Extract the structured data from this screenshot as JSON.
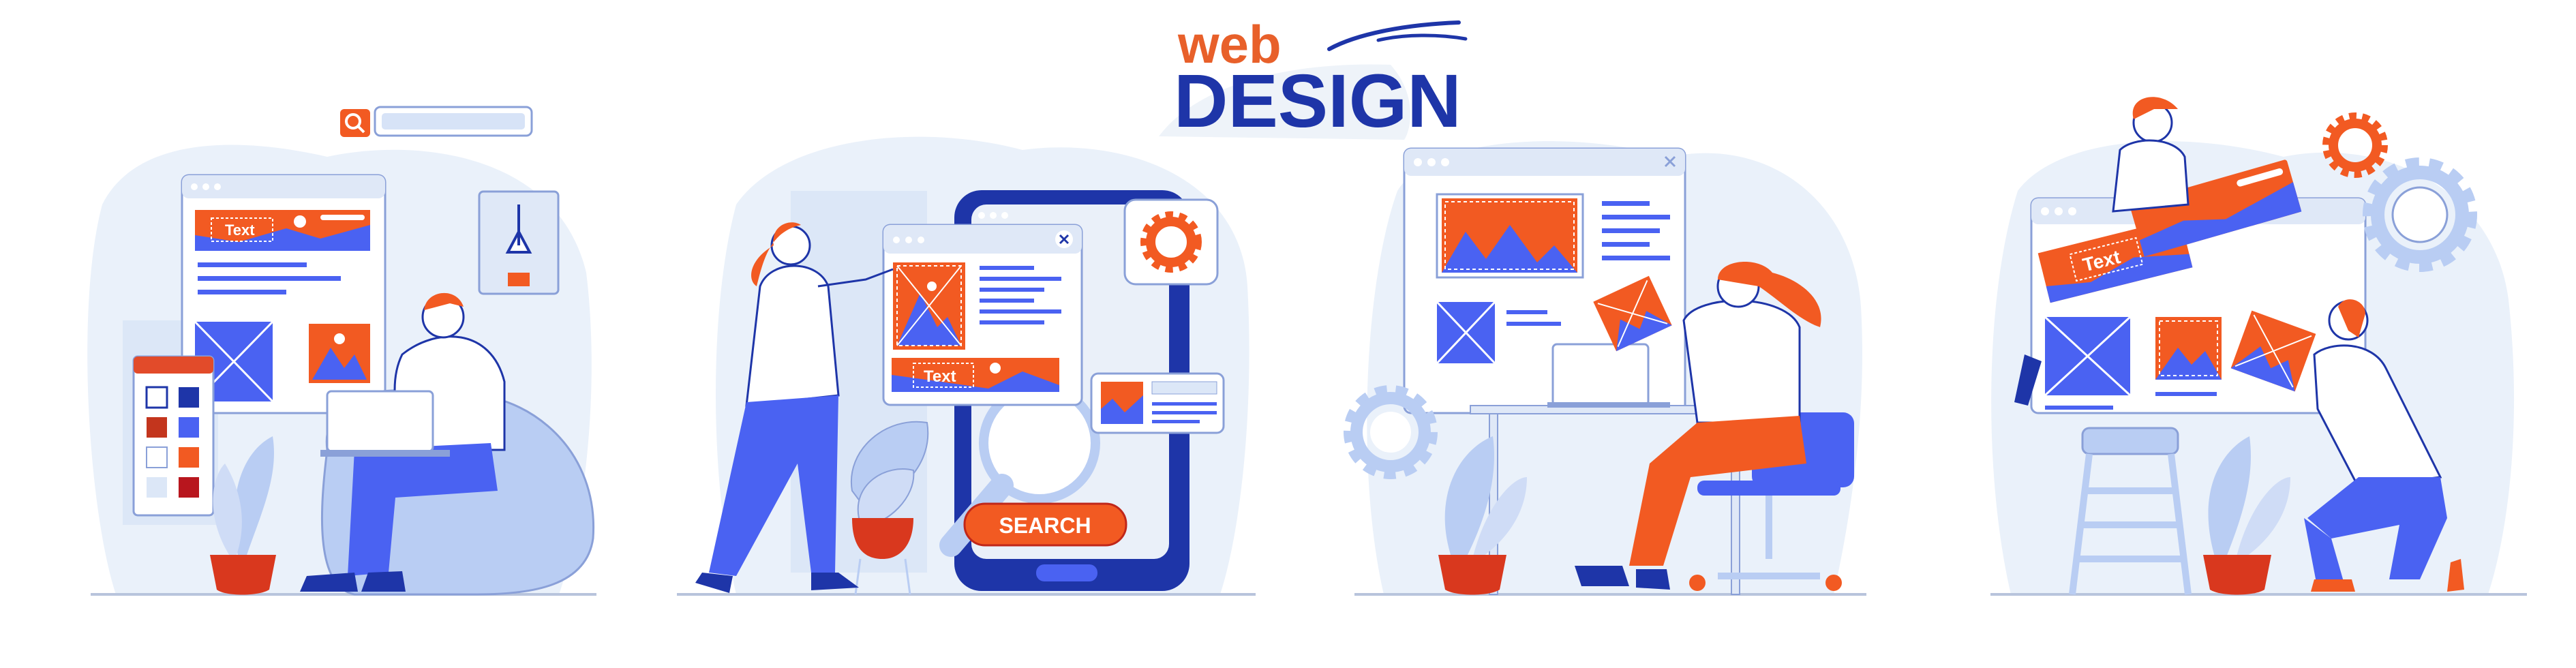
{
  "title": {
    "web": "web",
    "design": "DESIGN"
  },
  "scene1": {
    "banner_text": "Text"
  },
  "scene2": {
    "banner_text": "Text",
    "search_button": "SEARCH"
  },
  "scene4": {
    "banner_text": "Text"
  },
  "colors": {
    "orange": "#f25a22",
    "blue": "#4a62f2",
    "dark_blue": "#1e35a8",
    "light_blue": "#b9cdf3",
    "background_tint": "#eaf1fa"
  }
}
